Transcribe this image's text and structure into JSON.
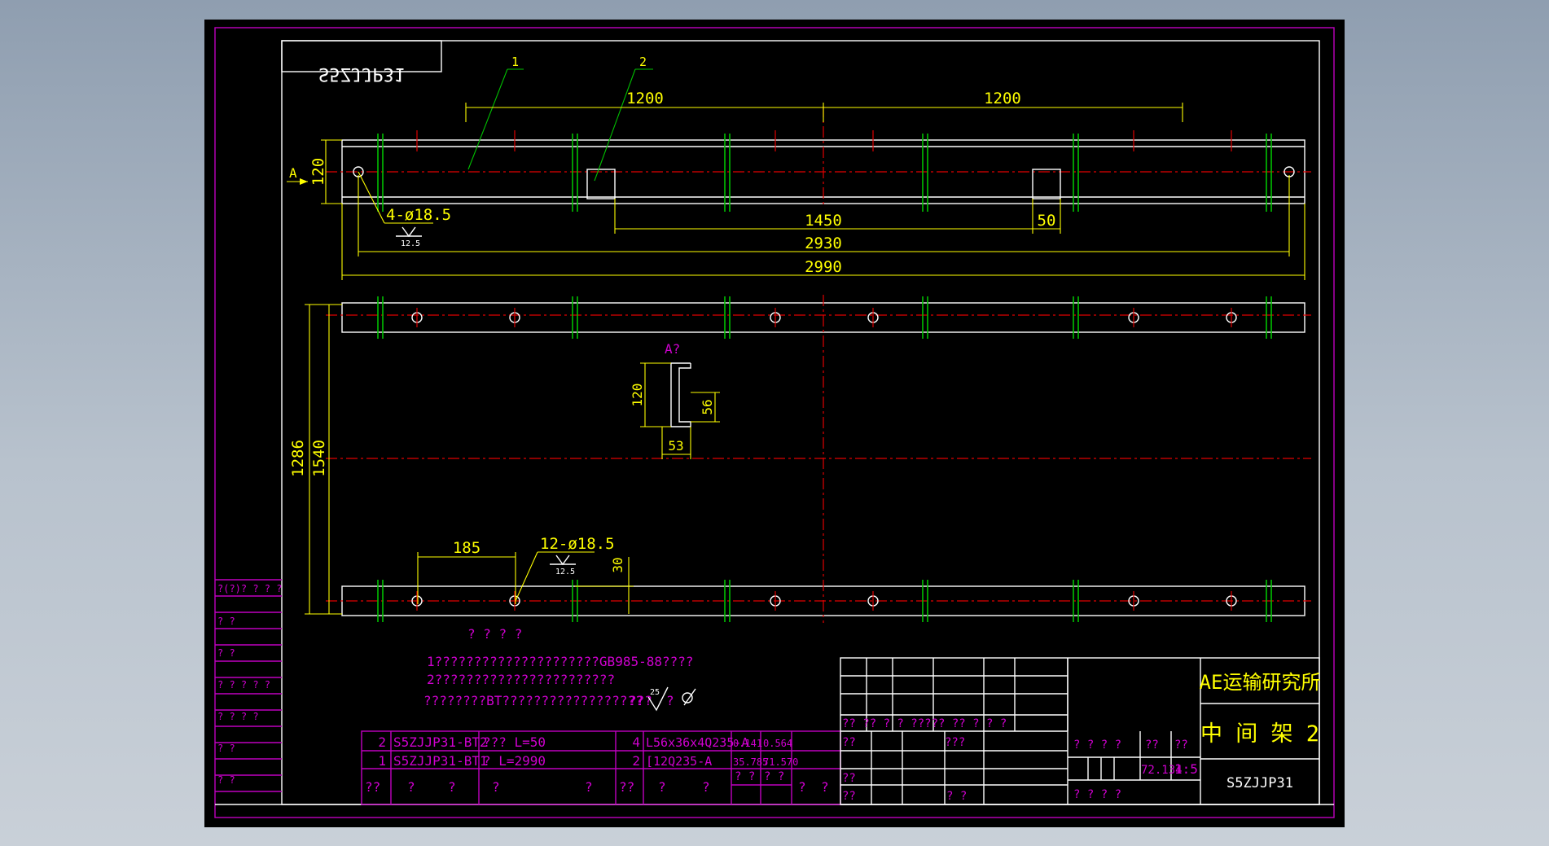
{
  "drawing_number_mirrored": "S5ZJJP31",
  "balloons": [
    "1",
    "2"
  ],
  "dims": {
    "span_left": "1200",
    "span_right": "1200",
    "height_120": "120",
    "view_a": "A",
    "hole_top": "4-ø18.5",
    "rough_top": "12.5",
    "d1450": "1450",
    "d50": "50",
    "d2930": "2930",
    "d2990": "2990",
    "d1286": "1286",
    "d1540": "1540",
    "d185": "185",
    "hole_bottom": "12-ø18.5",
    "rough_bottom": "12.5",
    "d30": "30"
  },
  "section": {
    "title": "A?",
    "h120": "120",
    "h56": "56",
    "w53": "53"
  },
  "notes": {
    "header": "? ? ? ?",
    "line1": "1?????????????????????GB985-88????",
    "line2": "2???????????????????????",
    "line3": "????????BT??????????????????",
    "rough_label": "???",
    "rough_value": "25",
    "rough_q": "?"
  },
  "left_strip": [
    "?(?)? ? ? ?",
    "?        ?",
    "?        ?",
    "? ? ? ? ?",
    "? ? ? ?",
    "?        ?",
    "?        ?"
  ],
  "bom": {
    "rows": [
      {
        "no": "2",
        "code": "S5ZJJP31-BT2",
        "name": "???  L=50",
        "qty": "4",
        "material": "L56x36x4Q235-A",
        "w1": "0.141",
        "w2": "0.564"
      },
      {
        "no": "1",
        "code": "S5ZJJP31-BT1",
        "name": "?  L=2990",
        "qty": "2",
        "material": "[12Q235-A",
        "w1": "35.785",
        "w2": "71.570"
      }
    ],
    "header": [
      "??",
      "?",
      "?",
      "?",
      "?",
      "??",
      "?",
      "?",
      "? ?",
      "? ?",
      "?",
      "?"
    ]
  },
  "title_block": {
    "institute": "AE运输研究所",
    "part_name": "中 间 架 2",
    "drawing_no": "S5ZJJP31",
    "weight": "72.134",
    "scale": "1:5",
    "row_marks": "?? ?? ?  ? ?????  ??  ?  ?  ?",
    "stage": "? ? ? ?",
    "sheet_marks": "?    ?   ?    ?",
    "labels": [
      "??",
      "???",
      "??",
      "??",
      "? ?",
      "??",
      "??"
    ]
  }
}
